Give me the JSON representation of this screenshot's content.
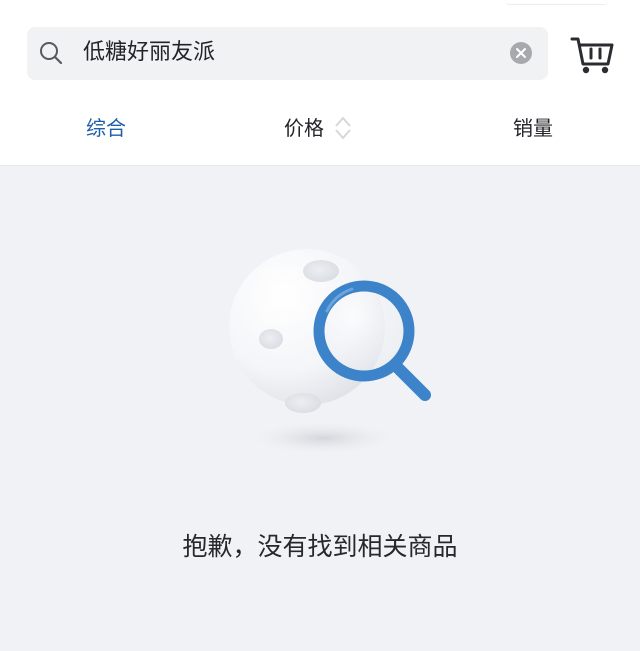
{
  "search": {
    "query": "低糖好丽友派"
  },
  "sort_tabs": [
    {
      "label": "综合",
      "active": true
    },
    {
      "label": "价格",
      "active": false
    },
    {
      "label": "销量",
      "active": false
    }
  ],
  "empty_state": {
    "message": "抱歉，没有找到相关商品"
  },
  "icons": {
    "search": "search-icon",
    "clear": "clear-icon",
    "cart": "shopping-cart-icon",
    "sort": "sort-arrows-icon",
    "empty": "moon-magnifier-icon"
  },
  "colors": {
    "accent": "#1f5ea8",
    "background": "#f1f2f5",
    "text": "#222428"
  }
}
